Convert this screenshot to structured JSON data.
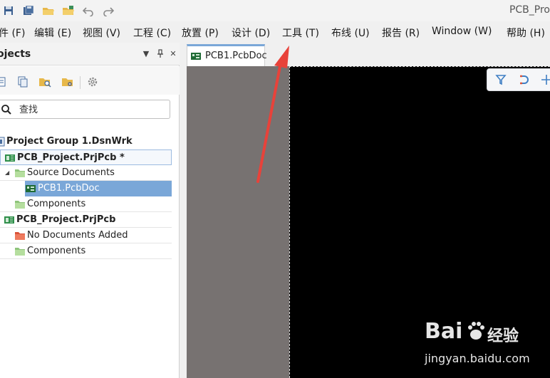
{
  "window": {
    "title": "PCB_Pro"
  },
  "quick_access": [
    {
      "name": "save-icon"
    },
    {
      "name": "save-all-icon"
    },
    {
      "name": "open-folder-icon"
    },
    {
      "name": "open-project-icon"
    },
    {
      "name": "undo-icon"
    },
    {
      "name": "redo-icon"
    }
  ],
  "menu": {
    "file": "件 (F)",
    "edit": "编辑 (E)",
    "view": "视图 (V)",
    "project": "工程 (C)",
    "place": "放置 (P)",
    "design": "设计 (D)",
    "tools": "工具 (T)",
    "route": "布线 (U)",
    "reports": "报告 (R)",
    "window": "Window (W)",
    "help": "帮助 (H)"
  },
  "panel": {
    "title": "ojects",
    "controls": {
      "menu": "▼",
      "pin": "⊣",
      "close": "✕"
    },
    "search": {
      "placeholder": "查找"
    },
    "tree": {
      "group": "Project Group 1.DsnWrk",
      "project1": "PCB_Project.PrjPcb *",
      "source_docs": "Source Documents",
      "pcbdoc": "PCB1.PcbDoc",
      "components1": "Components",
      "project2": "PCB_Project.PrjPcb",
      "no_docs": "No Documents Added",
      "components2": "Components"
    }
  },
  "doc": {
    "tab_label": "PCB1.PcbDoc"
  },
  "colors": {
    "selection": "#7aa7d8",
    "canvas_bg": "#000000",
    "canvas_gray": "#777271",
    "arrow": "#e8423a"
  },
  "watermark": {
    "brand": "Bai",
    "brand2": "du",
    "cn": "经验",
    "url": "jingyan.baidu.com"
  }
}
